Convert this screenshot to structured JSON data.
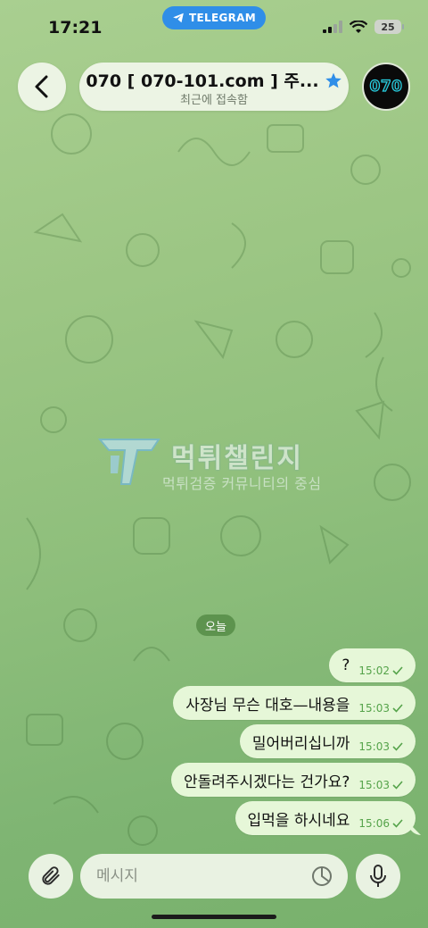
{
  "status_bar": {
    "time": "17:21",
    "banner": "TELEGRAM",
    "battery": "25",
    "icons": [
      "signal-icon",
      "wifi-icon",
      "battery-icon"
    ]
  },
  "header": {
    "title": "070 [ 070-101.com ] 주...",
    "subtitle": "최근에 접속함",
    "avatar_text": "070",
    "verified_icon": "star-icon",
    "accent": "#2f8ee8"
  },
  "watermark": {
    "title": "먹튀챌린지",
    "subtitle": "먹튀검증 커뮤니티의 중심"
  },
  "date_label": "오늘",
  "messages": [
    {
      "text": "?",
      "time": "15:02"
    },
    {
      "text": "사장님 무슨 대호—내용을",
      "time": "15:03"
    },
    {
      "text": "밀어버리십니까",
      "time": "15:03"
    },
    {
      "text": "안돌려주시겠다는 건가요?",
      "time": "15:03"
    },
    {
      "text": "입먹을 하시네요",
      "time": "15:06"
    }
  ],
  "input": {
    "placeholder": "메시지"
  },
  "colors": {
    "bubble": "#e6f7d8",
    "check": "#55a34a",
    "date_chip": "#568c46"
  }
}
